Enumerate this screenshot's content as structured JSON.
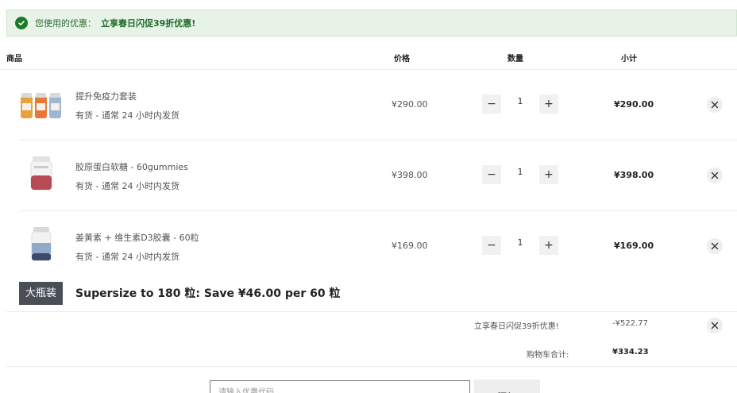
{
  "promo": {
    "label": "您使用的优惠：",
    "value": "立享春日闪促39折优惠!"
  },
  "columns": {
    "product": "商品",
    "price": "价格",
    "quantity": "数量",
    "subtotal": "小计"
  },
  "items": [
    {
      "name": "提升免疫力套装",
      "stock": "有货  -  通常 24 小时内发货",
      "price": "¥290.00",
      "quantity": "1",
      "subtotal": "¥290.00",
      "minus": "−",
      "plus": "+"
    },
    {
      "name": "胶原蛋白软糖 - 60gummies",
      "stock": "有货  -  通常 24 小时内发货",
      "price": "¥398.00",
      "quantity": "1",
      "subtotal": "¥398.00",
      "minus": "−",
      "plus": "+"
    },
    {
      "name": "姜黄素 + 维生素D3胶囊 - 60粒",
      "stock": "有货  -  通常 24 小时内发货",
      "price": "¥169.00",
      "quantity": "1",
      "subtotal": "¥169.00",
      "minus": "−",
      "plus": "+"
    }
  ],
  "upsell": {
    "badge": "大瓶装",
    "text": "Supersize to 180 粒: Save ¥46.00 per 60 粒"
  },
  "summary": {
    "discount_label": "立享春日闪促39折优惠!",
    "discount_value": "-¥522.77",
    "total_label": "购物车合计:",
    "total_value": "¥334.23"
  },
  "coupon": {
    "placeholder": "请输入优惠代码",
    "button": "添加"
  },
  "colors": {
    "promo_bg": "#e8f3e8",
    "promo_text": "#1e6a2a",
    "badge_bg": "#4a4f57"
  }
}
